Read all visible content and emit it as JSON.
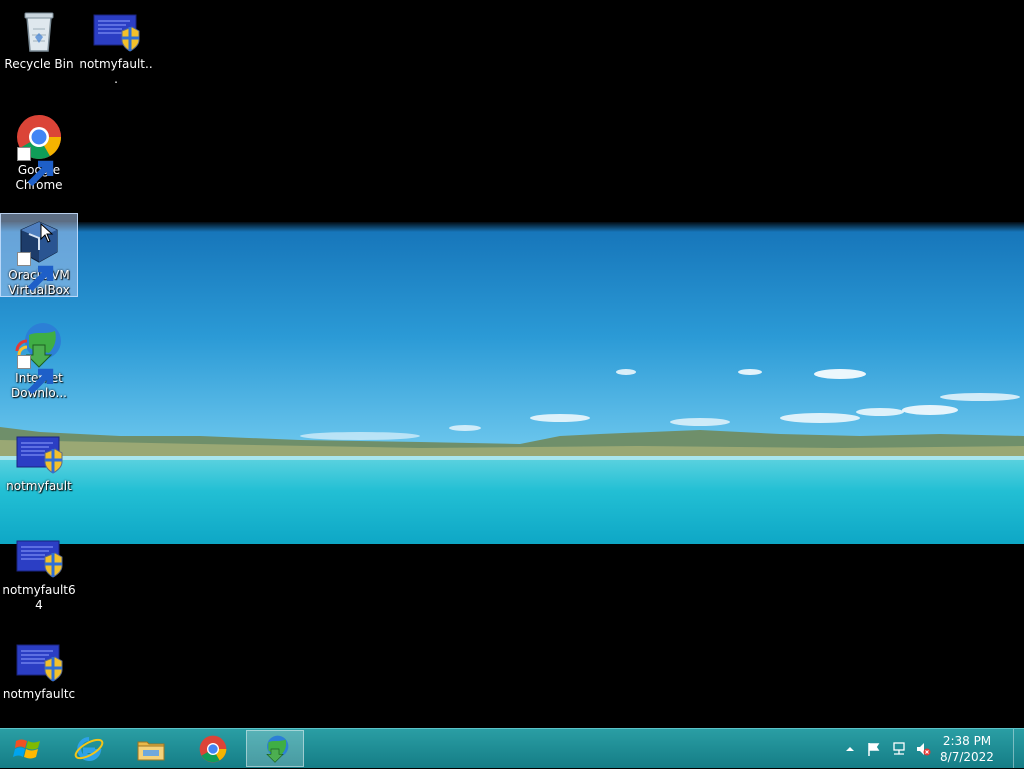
{
  "desktop": {
    "icons": [
      {
        "label": "Recycle Bin"
      },
      {
        "label": "notmyfault..."
      },
      {
        "label": "Google Chrome"
      },
      {
        "label": "Oracle VM VirtualBox"
      },
      {
        "label": "Internet Downlo..."
      },
      {
        "label": "notmyfault"
      },
      {
        "label": "notmyfault64"
      },
      {
        "label": "notmyfaultc"
      }
    ]
  },
  "taskbar": {
    "pinned": [
      {
        "name": "internet-explorer-icon"
      },
      {
        "name": "file-explorer-icon"
      },
      {
        "name": "chrome-icon"
      },
      {
        "name": "internet-download-manager-icon"
      }
    ],
    "clock": {
      "time": "2:38 PM",
      "date": "8/7/2022"
    }
  },
  "colors": {
    "taskbar": "#1a8c94",
    "desktop_background": "#000000",
    "selection": "#aac8f0"
  }
}
